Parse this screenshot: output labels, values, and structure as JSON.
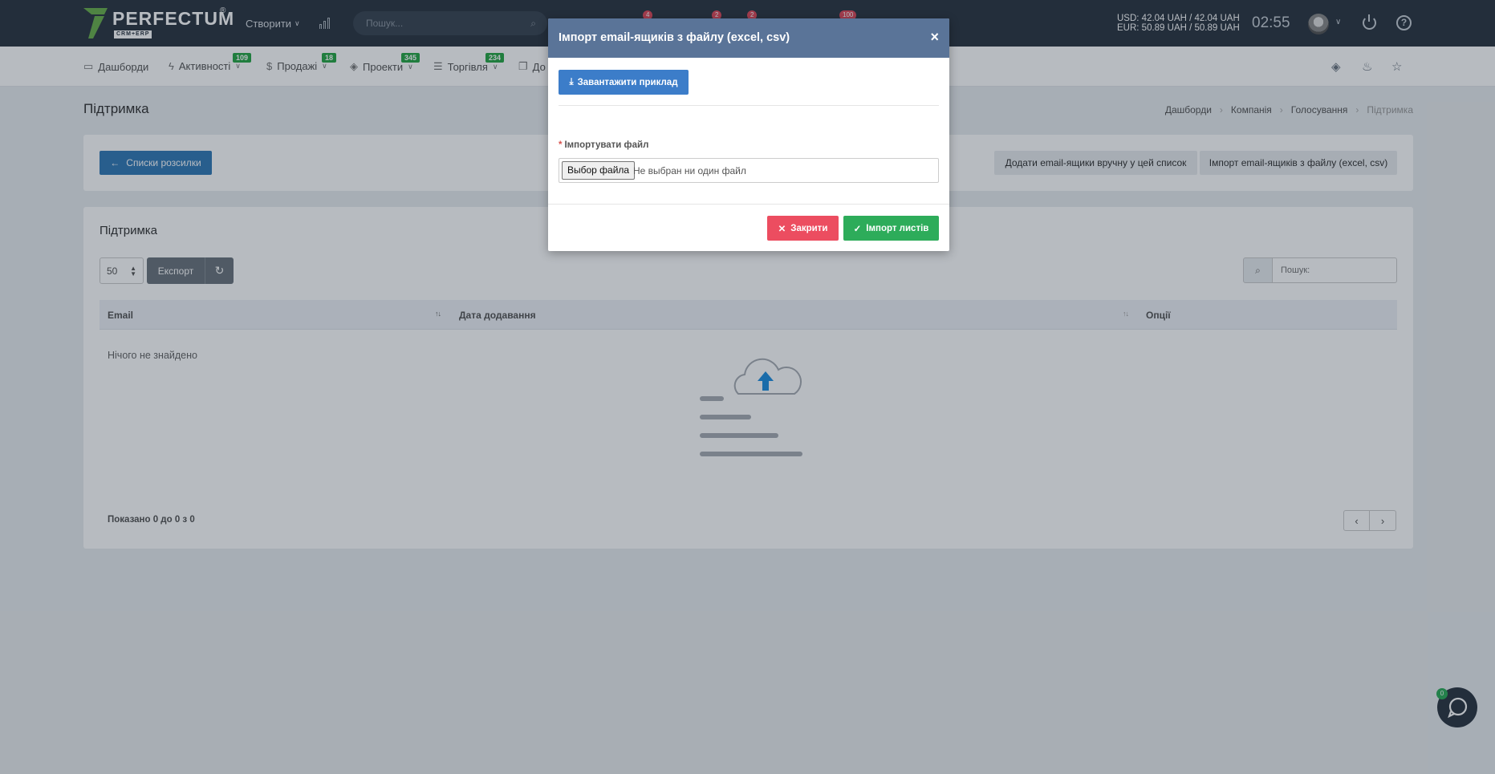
{
  "topbar": {
    "logo_text": "PERFECTUM",
    "logo_sub": "CRM+ERP",
    "logo_reg": "®",
    "create_label": "Створити",
    "search_placeholder": "Пошук...",
    "badges": [
      "4",
      "2",
      "2",
      "100"
    ],
    "currency_usd": "USD: 42.04 UAH / 42.04 UAH",
    "currency_eur": "EUR: 50.89 UAH / 50.89 UAH",
    "clock": "02:55"
  },
  "nav": {
    "items": [
      {
        "label": "Дашборди",
        "badge": ""
      },
      {
        "label": "Активності",
        "badge": "109"
      },
      {
        "label": "Продажі",
        "badge": "18"
      },
      {
        "label": "Проекти",
        "badge": "345"
      },
      {
        "label": "Торгівля",
        "badge": "234"
      },
      {
        "label": "До",
        "badge": ""
      }
    ]
  },
  "page": {
    "title": "Підтримка",
    "breadcrumb": [
      "Дашборди",
      "Компанія",
      "Голосування",
      "Підтримка"
    ],
    "back_button": "Списки розсилки",
    "add_manual_button": "Додати email-ящики вручну у цей список",
    "import_button": "Імпорт email-ящиків з файлу (excel, csv)"
  },
  "table_card": {
    "title": "Підтримка",
    "page_size": "50",
    "export_label": "Експорт",
    "search_placeholder": "Пошук:",
    "columns": [
      "Email",
      "Дата додавання",
      "Опції"
    ],
    "empty_text": "Нічого не знайдено",
    "shown_text": "Показано 0 до 0 з 0"
  },
  "modal": {
    "title": "Імпорт email-ящиків з файлу (excel, csv)",
    "download_label": "Завантажити приклад",
    "file_label": "Імпортувати файл",
    "required_mark": "*",
    "choose_label": "Выбор файла",
    "no_file_text": "Не выбран ни один файл",
    "close_label": "Закрити",
    "import_label": "Імпорт листів"
  },
  "chat": {
    "badge": "0"
  },
  "colors": {
    "topbar": "#2b3541",
    "primary": "#337ab7",
    "modal_header": "#5a7498",
    "danger": "#ec4d60",
    "success": "#2dac5a"
  }
}
